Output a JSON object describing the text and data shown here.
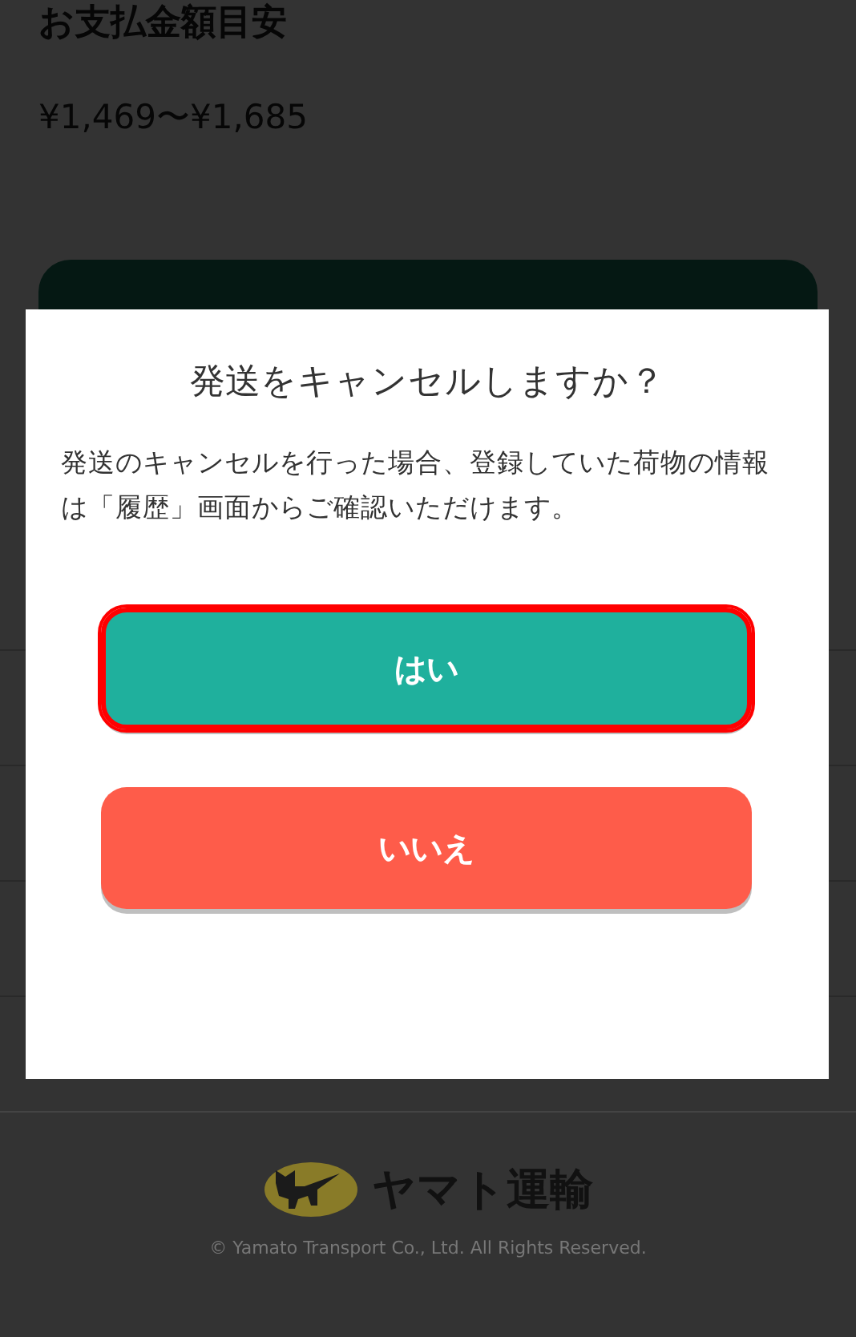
{
  "page": {
    "heading": "お支払金額目安",
    "price": "¥1,469〜¥1,685",
    "footer": {
      "logo_text": "ヤマト運輸",
      "copyright": "© Yamato Transport Co., Ltd. All Rights Reserved."
    }
  },
  "dialog": {
    "title": "発送をキャンセルしますか？",
    "message": "発送のキャンセルを行った場合、登録していた荷物の情報は「履歴」画面からご確認いただけます。",
    "buttons": [
      {
        "label": "はい",
        "kind": "confirm",
        "focused": true
      },
      {
        "label": "いいえ",
        "kind": "cancel",
        "focused": false
      }
    ]
  }
}
